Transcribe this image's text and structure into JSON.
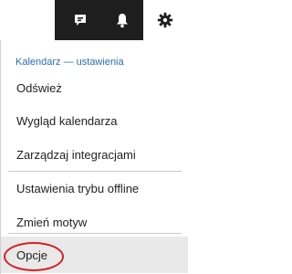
{
  "toolbar": {
    "chat_icon": "chat-bubble-icon",
    "bell_icon": "bell-icon",
    "gear_icon": "gear-icon"
  },
  "menu": {
    "header": "Kalendarz — ustawienia",
    "items": [
      {
        "label": "Odśwież"
      },
      {
        "label": "Wygląd kalendarza"
      },
      {
        "label": "Zarządzaj integracjami"
      },
      {
        "label": "Ustawienia trybu offline"
      },
      {
        "label": "Zmień motyw"
      },
      {
        "label": "Opcje"
      }
    ]
  },
  "colors": {
    "toolbar_bg": "#1e1e1e",
    "header_text": "#2b6cb0",
    "highlight_bg": "#e9e9e9",
    "annotation_circle": "#d61f26"
  }
}
